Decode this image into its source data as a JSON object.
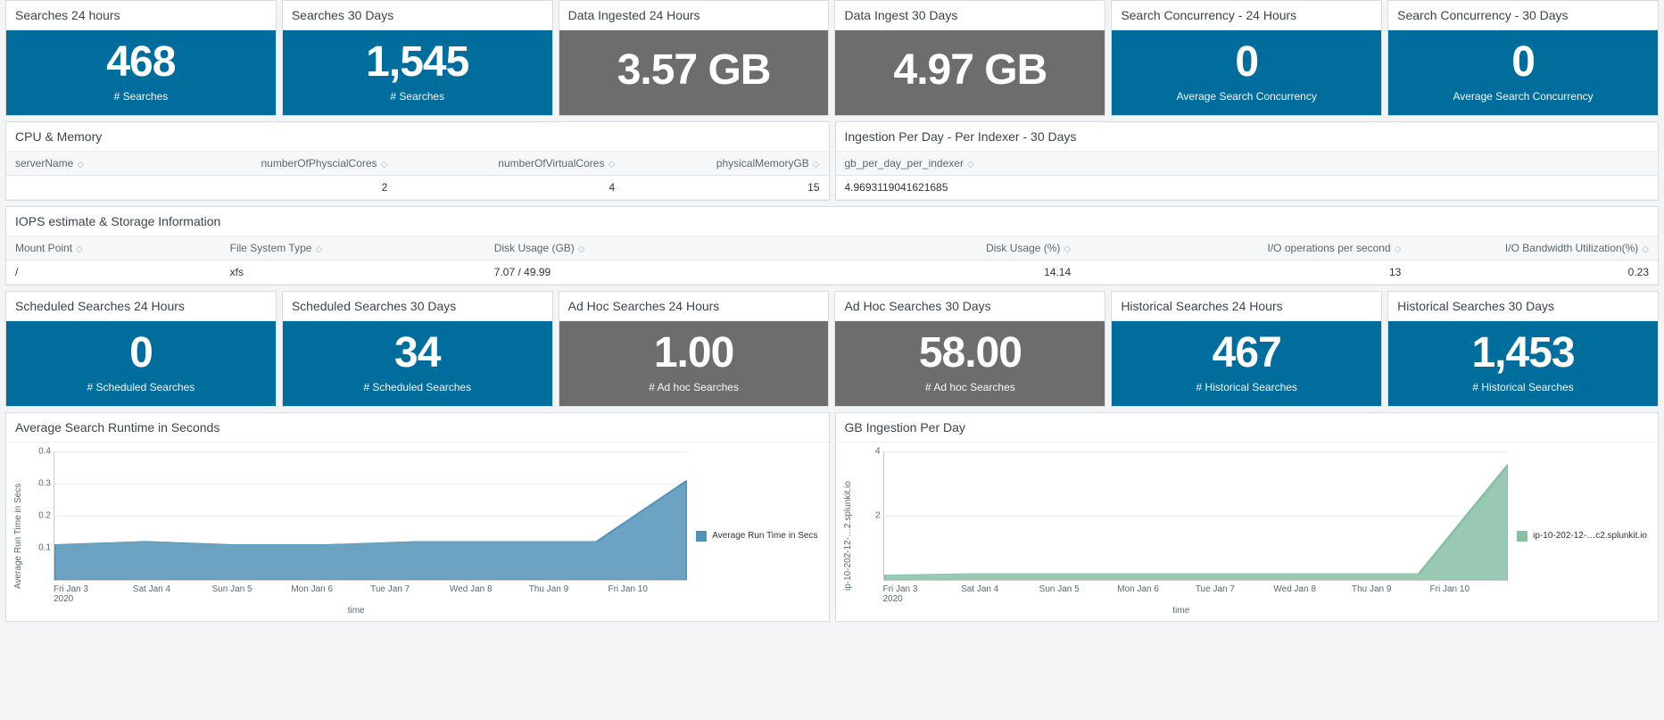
{
  "row1": [
    {
      "title": "Searches 24 hours",
      "value": "468",
      "sub": "# Searches",
      "cls": "sv-teal"
    },
    {
      "title": "Searches 30 Days",
      "value": "1,545",
      "sub": "# Searches",
      "cls": "sv-teal"
    },
    {
      "title": "Data Ingested 24 Hours",
      "value": "3.57 GB",
      "sub": "",
      "cls": "sv-gray"
    },
    {
      "title": "Data Ingest 30 Days",
      "value": "4.97 GB",
      "sub": "",
      "cls": "sv-gray"
    },
    {
      "title": "Search Concurrency - 24 Hours",
      "value": "0",
      "sub": "Average Search Concurrency",
      "cls": "sv-teal"
    },
    {
      "title": "Search Concurrency - 30 Days",
      "value": "0",
      "sub": "Average Search Concurrency",
      "cls": "sv-teal"
    }
  ],
  "cpu_mem": {
    "title": "CPU & Memory",
    "headers": [
      "serverName",
      "numberOfPhyscialCores",
      "numberOfVirtualCores",
      "physicalMemoryGB"
    ],
    "row": {
      "server": "",
      "cores": "2",
      "vcores": "4",
      "mem": "15"
    }
  },
  "ingest_per_day": {
    "title": "Ingestion Per Day - Per Indexer - 30 Days",
    "header": "gb_per_day_per_indexer",
    "value": "4.9693119041621685"
  },
  "iops": {
    "title": "IOPS estimate & Storage Information",
    "headers": {
      "mount": "Mount Point",
      "fs": "File System Type",
      "du_gb": "Disk Usage (GB)",
      "du_pct": "Disk Usage (%)",
      "iops": "I/O operations per second",
      "bw": "I/O Bandwidth Utilization(%)"
    },
    "row": {
      "mount": "/",
      "fs": "xfs",
      "du_gb": "7.07 / 49.99",
      "du_pct": "14.14",
      "iops": "13",
      "bw": "0.23"
    }
  },
  "row3": [
    {
      "title": "Scheduled Searches 24 Hours",
      "value": "0",
      "sub": "# Scheduled Searches",
      "cls": "sv-teal"
    },
    {
      "title": "Scheduled Searches 30 Days",
      "value": "34",
      "sub": "# Scheduled Searches",
      "cls": "sv-teal"
    },
    {
      "title": "Ad Hoc Searches 24 Hours",
      "value": "1.00",
      "sub": "# Ad hoc Searches",
      "cls": "sv-gray"
    },
    {
      "title": "Ad Hoc Searches 30 Days",
      "value": "58.00",
      "sub": "# Ad hoc Searches",
      "cls": "sv-gray"
    },
    {
      "title": "Historical Searches 24 Hours",
      "value": "467",
      "sub": "# Historical Searches",
      "cls": "sv-teal"
    },
    {
      "title": "Historical Searches 30 Days",
      "value": "1,453",
      "sub": "# Historical Searches",
      "cls": "sv-teal"
    }
  ],
  "chart_left": {
    "title": "Average Search Runtime in Seconds",
    "ylabel": "Average Run Time in Secs",
    "xlabel": "time",
    "legend": "Average Run Time in Secs",
    "color": "#5293b8"
  },
  "chart_right": {
    "title": "GB Ingestion Per Day",
    "ylabel": "ip-10-202-12-…2.splunkit.io",
    "xlabel": "time",
    "legend": "ip-10-202-12-…c2.splunkit.io",
    "color": "#88c0a6"
  },
  "chart_data": [
    {
      "type": "area",
      "title": "Average Search Runtime in Seconds",
      "xlabel": "time",
      "ylabel": "Average Run Time in Secs",
      "ylim": [
        0,
        0.4
      ],
      "yticks": [
        0.1,
        0.2,
        0.3,
        0.4
      ],
      "categories": [
        "Fri Jan 3 2020",
        "Sat Jan 4",
        "Sun Jan 5",
        "Mon Jan 6",
        "Tue Jan 7",
        "Wed Jan 8",
        "Thu Jan 9",
        "Fri Jan 10"
      ],
      "series": [
        {
          "name": "Average Run Time in Secs",
          "values": [
            0.11,
            0.12,
            0.11,
            0.11,
            0.12,
            0.12,
            0.12,
            0.31
          ]
        }
      ]
    },
    {
      "type": "area",
      "title": "GB Ingestion Per Day",
      "xlabel": "time",
      "ylabel": "ip-10-202-12-…2.splunkit.io",
      "ylim": [
        0,
        4
      ],
      "yticks": [
        2,
        4
      ],
      "categories": [
        "Fri Jan 3 2020",
        "Sat Jan 4",
        "Sun Jan 5",
        "Mon Jan 6",
        "Tue Jan 7",
        "Wed Jan 8",
        "Thu Jan 9",
        "Fri Jan 10"
      ],
      "series": [
        {
          "name": "ip-10-202-12-…c2.splunkit.io",
          "values": [
            0.15,
            0.2,
            0.2,
            0.2,
            0.2,
            0.2,
            0.2,
            3.6
          ]
        }
      ]
    }
  ]
}
